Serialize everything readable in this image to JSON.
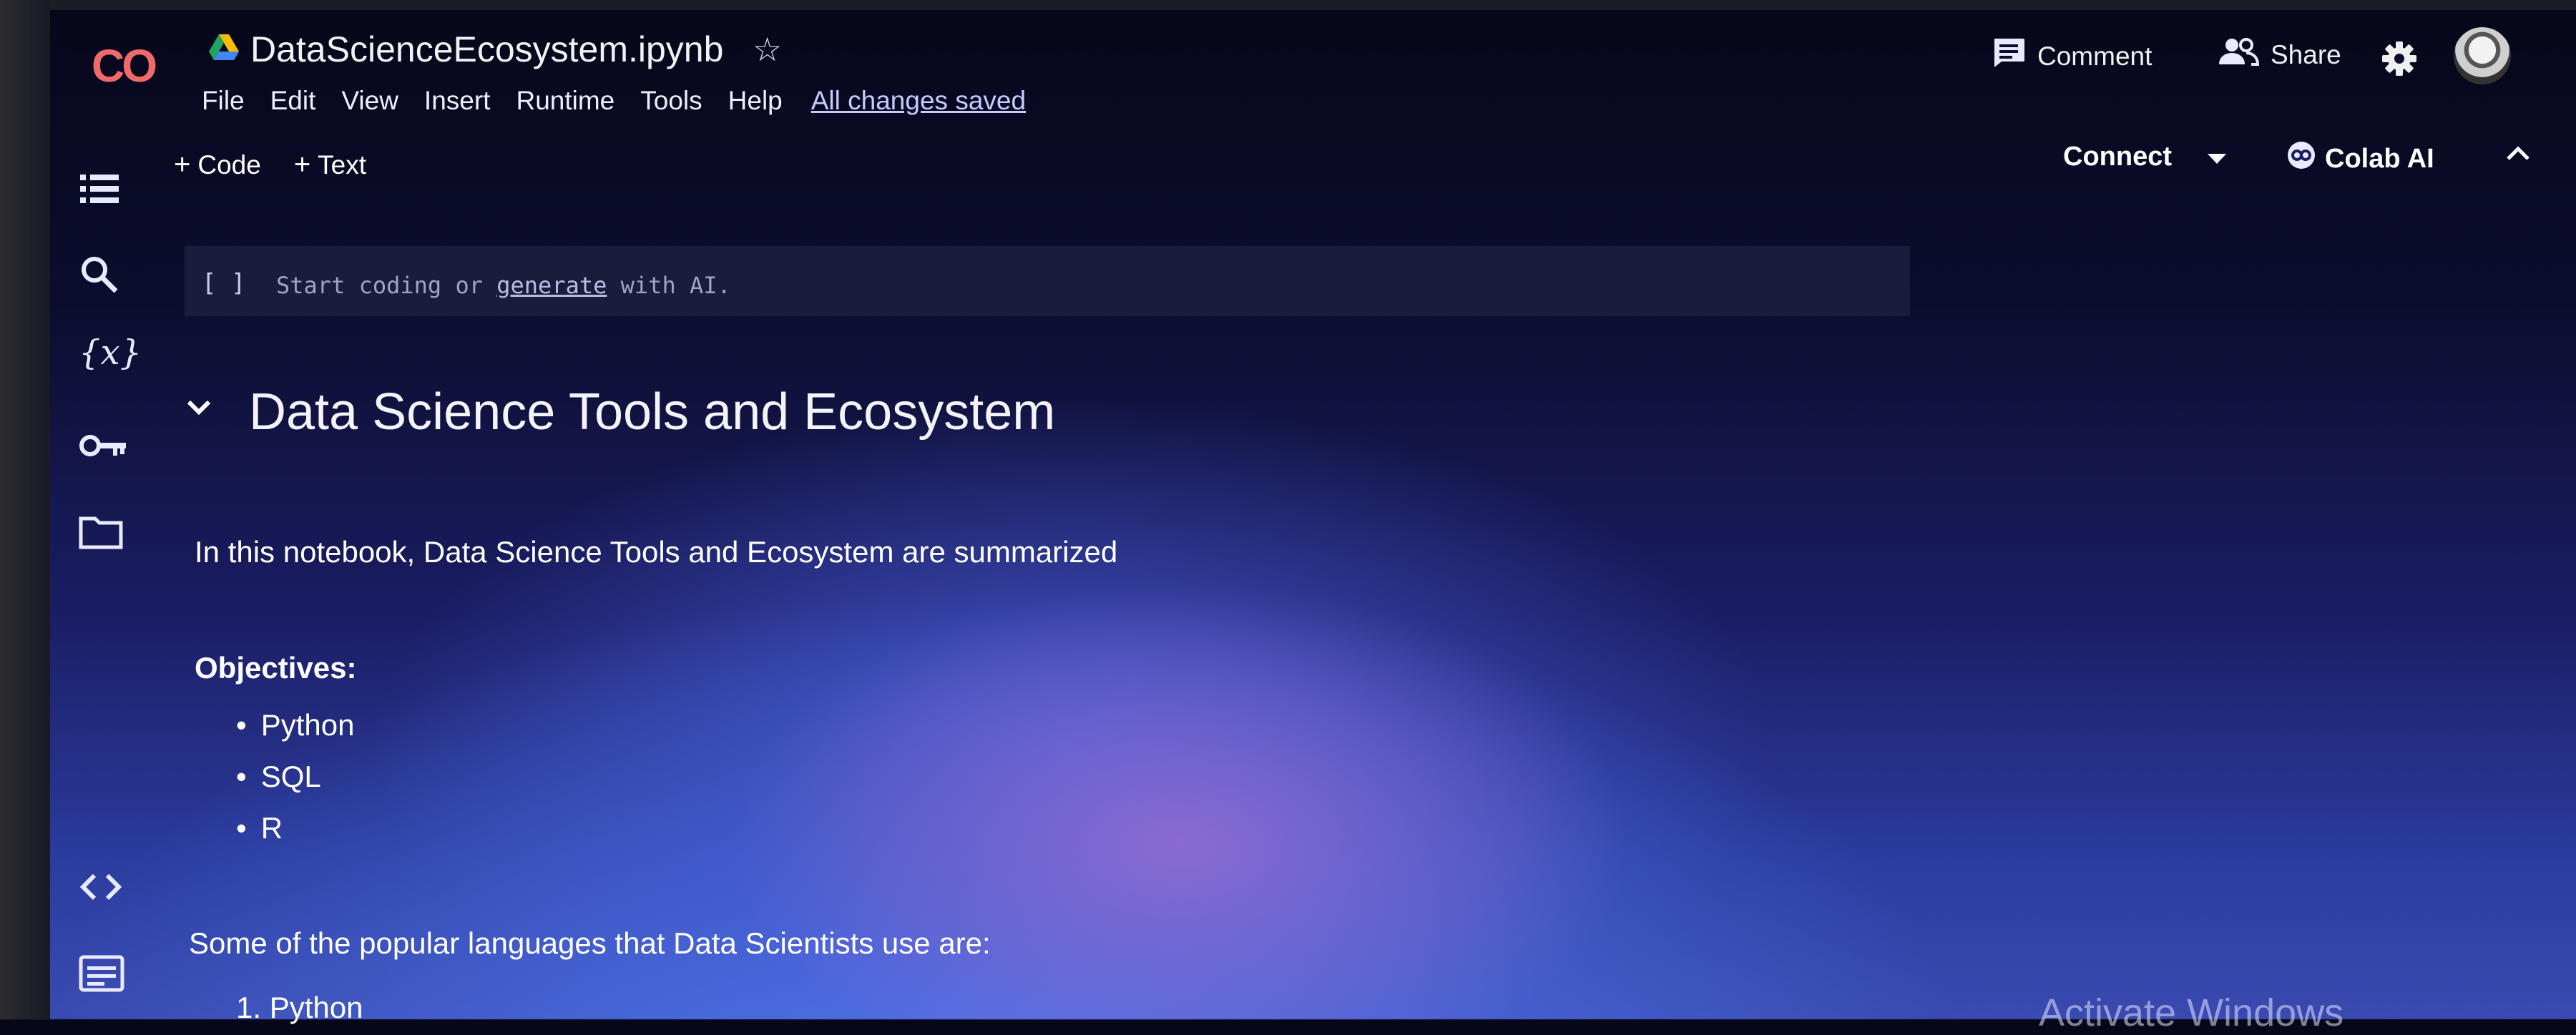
{
  "app": {
    "logo": "CO",
    "title": "DataScienceEcosystem.ipynb",
    "save_status": "All changes saved"
  },
  "menu": [
    "File",
    "Edit",
    "View",
    "Insert",
    "Runtime",
    "Tools",
    "Help"
  ],
  "toolbar": {
    "add_code": "Code",
    "add_text": "Text",
    "comment": "Comment",
    "share": "Share",
    "connect": "Connect",
    "colab_ai": "Colab AI"
  },
  "code_cell": {
    "brackets": "[ ]",
    "placeholder_start": "Start coding or",
    "placeholder_link": "generate",
    "placeholder_end": "with AI."
  },
  "notebook": {
    "heading": "Data Science Tools and Ecosystem",
    "intro": "In this notebook, Data Science Tools and Ecosystem are summarized",
    "objectives_label": "Objectives:",
    "objectives": [
      "Python",
      "SQL",
      "R"
    ],
    "languages_intro": "Some of the popular languages that Data Scientists use are:",
    "languages": [
      "1. Python"
    ]
  },
  "overlay": {
    "activate_windows": "Activate Windows"
  },
  "colors": {
    "logo": "#f06a6a",
    "background": "#0c0d2e"
  }
}
